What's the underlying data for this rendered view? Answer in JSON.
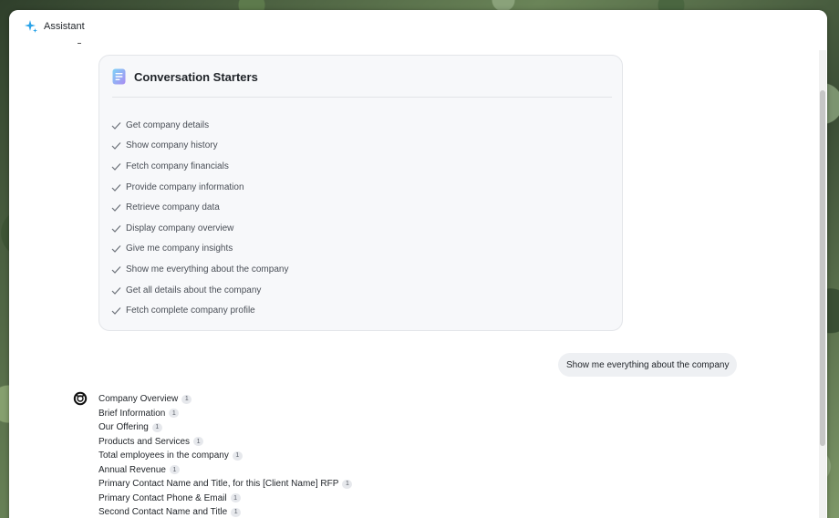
{
  "window": {
    "title": "Assistant",
    "app_icon": "sparkle-icon"
  },
  "starters": {
    "title": "Conversation Starters",
    "icon": "document-icon",
    "items": [
      "Get company details",
      "Show company history",
      "Fetch company financials",
      "Provide company information",
      "Retrieve company data",
      "Display company overview",
      "Give me company insights",
      "Show me everything about the company",
      "Get all details about the company",
      "Fetch complete company profile"
    ]
  },
  "user_message": "Show me everything about the company",
  "answer": {
    "items": [
      {
        "text": "Company Overview",
        "cite": "1"
      },
      {
        "text": "Brief Information",
        "cite": "1"
      },
      {
        "text": "Our Offering",
        "cite": "1"
      },
      {
        "text": "Products and Services",
        "cite": "1"
      },
      {
        "text": "Total employees in the company",
        "cite": "1"
      },
      {
        "text": "Annual Revenue",
        "cite": "1"
      },
      {
        "text": "Primary Contact Name and Title, for this [Client Name] RFP",
        "cite": "1"
      },
      {
        "text": "Primary Contact Phone & Email",
        "cite": "1"
      },
      {
        "text": "Second Contact Name and Title",
        "cite": "1"
      }
    ]
  },
  "colors": {
    "accent": "#2aa3e8",
    "check": "#6b7078"
  }
}
